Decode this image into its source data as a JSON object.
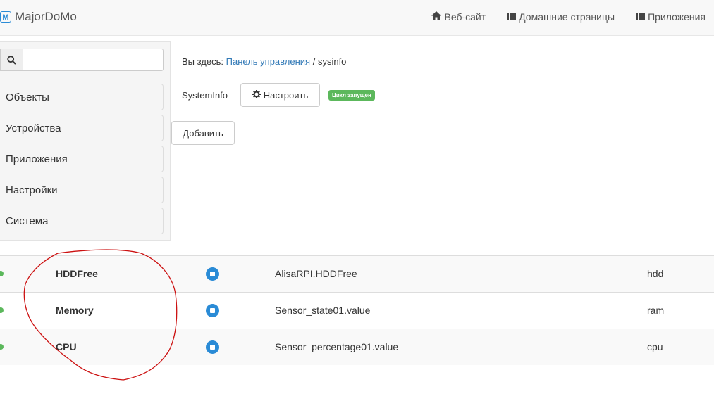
{
  "navbar": {
    "brand_logo": "M",
    "brand": "MajorDoMo",
    "links": [
      {
        "label": "Веб-сайт",
        "icon": "home-icon"
      },
      {
        "label": "Домашние страницы",
        "icon": "list-icon"
      },
      {
        "label": "Приложения",
        "icon": "list-icon"
      }
    ]
  },
  "sidebar": {
    "search": {
      "value": "",
      "placeholder": "",
      "icon": "search-icon"
    },
    "items": [
      {
        "label": "Объекты"
      },
      {
        "label": "Устройства"
      },
      {
        "label": "Приложения"
      },
      {
        "label": "Настройки"
      },
      {
        "label": "Система"
      }
    ]
  },
  "breadcrumb": {
    "prefix": "Вы здесь:",
    "link": "Панель управления",
    "separator": "/",
    "current": "sysinfo"
  },
  "module": {
    "name": "SystemInfo",
    "configure_label": "Настроить",
    "configure_icon": "gear-icon",
    "status_badge": "Цикл запущен",
    "status_color": "#5cb85c",
    "add_label": "Добавить"
  },
  "table": {
    "rows": [
      {
        "status_color": "#5cb85c",
        "name": "HDDFree",
        "linked": "AlisaRPI.HDDFree",
        "code": "hdd"
      },
      {
        "status_color": "#5cb85c",
        "name": "Memory",
        "linked": "Sensor_state01.value",
        "code": "ram"
      },
      {
        "status_color": "#5cb85c",
        "name": "CPU",
        "linked": "Sensor_percentage01.value",
        "code": "cpu"
      }
    ]
  },
  "colors": {
    "accent": "#337ab7",
    "icon_blue": "#2a8bd6",
    "annotation": "#cc1111"
  }
}
